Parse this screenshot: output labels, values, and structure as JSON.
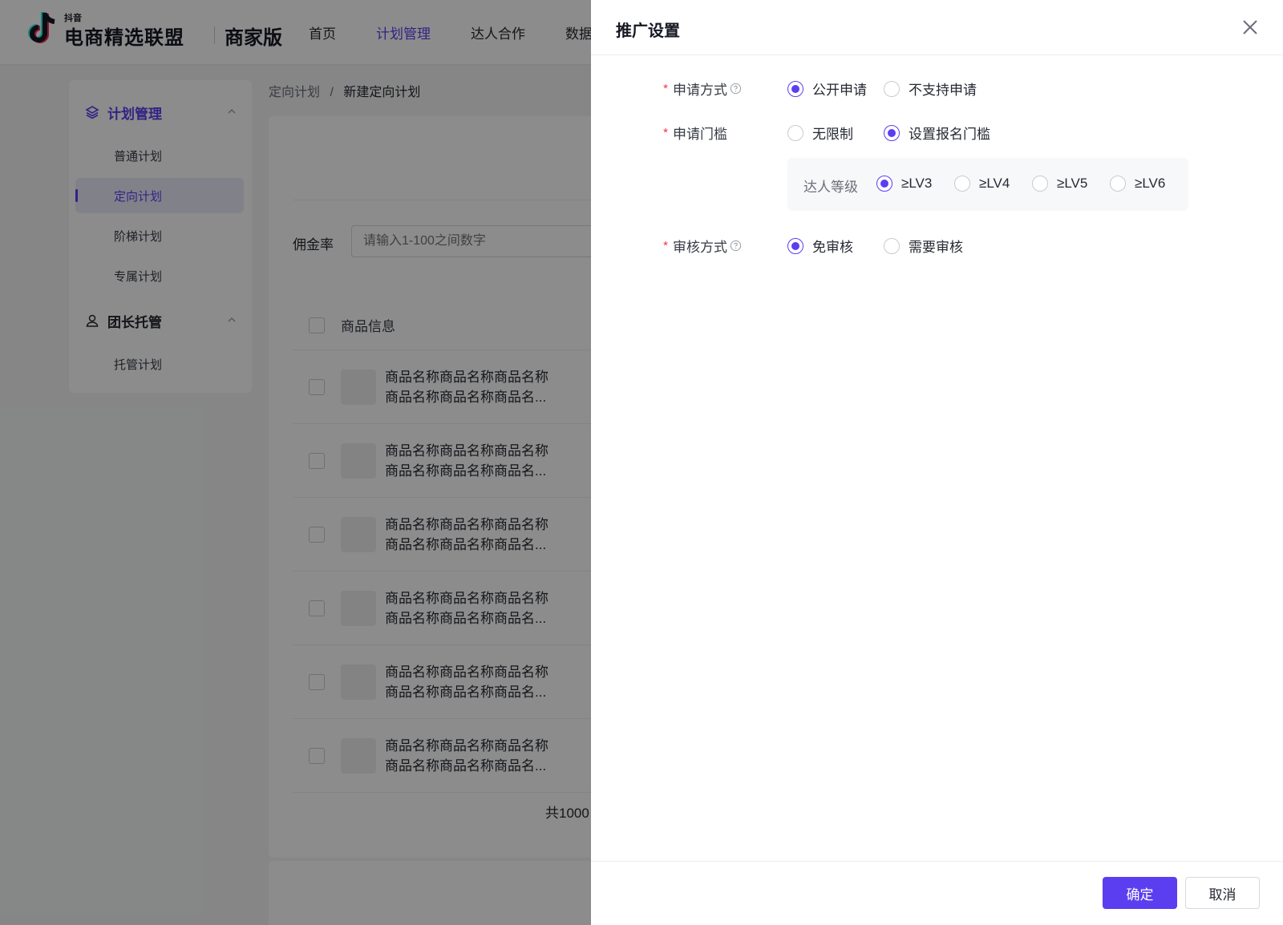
{
  "header": {
    "logo_sub": "抖音",
    "logo_main": "电商精选联盟",
    "logo_edition": "商家版",
    "nav": [
      "首页",
      "计划管理",
      "达人合作",
      "数据"
    ]
  },
  "sidebar": {
    "groups": [
      {
        "label": "计划管理",
        "items": [
          "普通计划",
          "定向计划",
          "阶梯计划",
          "专属计划"
        ]
      },
      {
        "label": "团长托管",
        "items": [
          "托管计划"
        ]
      }
    ]
  },
  "breadcrumb": {
    "parent": "定向计划",
    "separator": "/",
    "current": "新建定向计划"
  },
  "content": {
    "commission_label": "佣金率",
    "commission_placeholder": "请输入1-100之间数字",
    "column_product_info": "商品信息",
    "rows": [
      {
        "line1": "商品名称商品名称商品名称",
        "line2": "商品名称商品名称商品名..."
      },
      {
        "line1": "商品名称商品名称商品名称",
        "line2": "商品名称商品名称商品名..."
      },
      {
        "line1": "商品名称商品名称商品名称",
        "line2": "商品名称商品名称商品名..."
      },
      {
        "line1": "商品名称商品名称商品名称",
        "line2": "商品名称商品名称商品名..."
      },
      {
        "line1": "商品名称商品名称商品名称",
        "line2": "商品名称商品名称商品名..."
      },
      {
        "line1": "商品名称商品名称商品名称",
        "line2": "商品名称商品名称商品名..."
      }
    ],
    "total_text": "共1000"
  },
  "drawer": {
    "title": "推广设置",
    "apply_method": {
      "label": "申请方式",
      "options": [
        "公开申请",
        "不支持申请"
      ],
      "selected": "公开申请"
    },
    "apply_threshold": {
      "label": "申请门槛",
      "options": [
        "无限制",
        "设置报名门槛"
      ],
      "selected": "设置报名门槛"
    },
    "talent_level": {
      "label": "达人等级",
      "options": [
        "≥LV3",
        "≥LV4",
        "≥LV5",
        "≥LV6"
      ],
      "selected": "≥LV3"
    },
    "review_method": {
      "label": "审核方式",
      "options": [
        "免审核",
        "需要审核"
      ],
      "selected": "免审核"
    },
    "confirm_label": "确定",
    "cancel_label": "取消"
  },
  "colors": {
    "accent": "#5c3ef1",
    "required": "#f5313a"
  }
}
